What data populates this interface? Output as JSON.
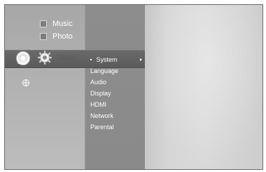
{
  "left_menu": {
    "music": "Music",
    "photo": "Photo",
    "setup": "Setup",
    "dvd_badge": "DVD"
  },
  "submenu": {
    "items": [
      "System",
      "Language",
      "Audio",
      "Display",
      "HDMI",
      "Network",
      "Parental"
    ],
    "selected": "System"
  },
  "icons": {
    "music": "music-note-icon",
    "photo": "photo-icon",
    "disc": "disc-icon",
    "gear": "gear-icon",
    "globe": "globe-icon"
  },
  "colors": {
    "highlight": "#5f5f5f",
    "text": "#ffffff",
    "setup_text": "#5b5b5b"
  }
}
